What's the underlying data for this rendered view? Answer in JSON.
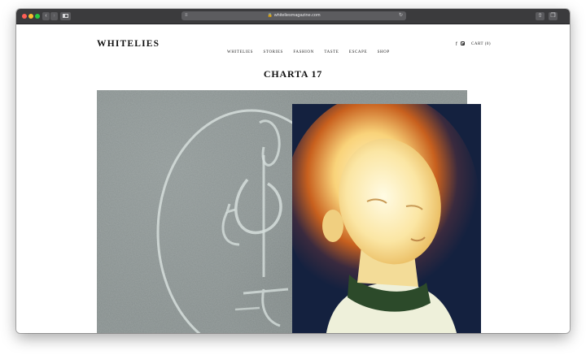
{
  "browser": {
    "url": "whiteliesmagazine.com",
    "back_glyph": "‹",
    "forward_glyph": "›",
    "reader_glyph": "≡",
    "reload_glyph": "↻",
    "lock_glyph": "🔒",
    "share_glyph": "⇧",
    "tabs_glyph": "❐",
    "new_tab_glyph": "+"
  },
  "site": {
    "logo": "WHITELIES",
    "nav": [
      "WHITELIES",
      "STORIES",
      "FASHION",
      "TASTE",
      "ESCAPE",
      "SHOP"
    ],
    "facebook_glyph": "f",
    "cart_label": "CART (0)"
  },
  "article": {
    "title": "CHARTA 17"
  },
  "colors": {
    "toolbar": "#3b3b3d",
    "chalkboard": "#858d8c",
    "portrait_bg": "#14213f",
    "glow": "#f7a535"
  },
  "icons": {
    "facebook": "facebook-icon",
    "instagram": "instagram-icon",
    "share": "share-icon",
    "tabs": "tabs-icon"
  }
}
